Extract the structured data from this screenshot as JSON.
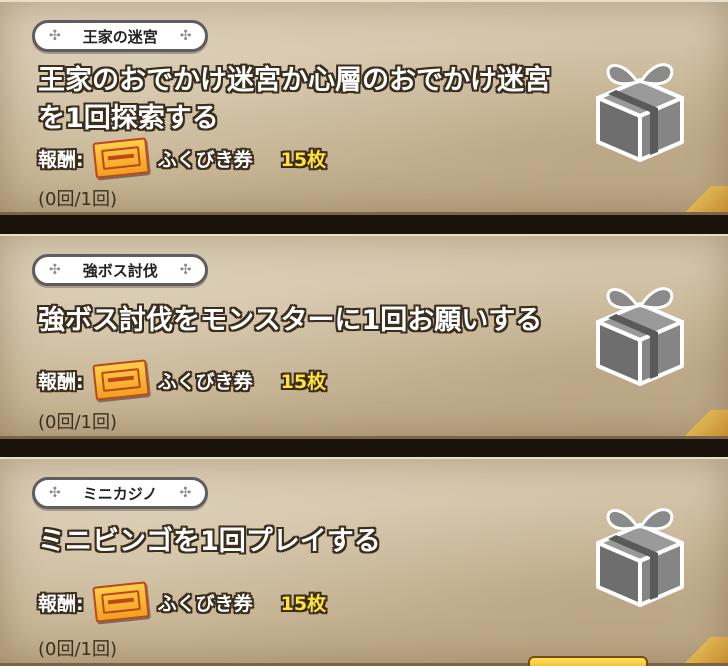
{
  "missions": [
    {
      "category": "王家の迷宮",
      "title_line1": "王家のおでかけ迷宮か心層のおでかけ迷宮",
      "title_line2": "を1回探索する",
      "reward_label": "報酬:",
      "reward_item": "ふくびき券",
      "reward_count": "15枚",
      "progress": "(0回/1回)",
      "reward_icon": "ticket-icon",
      "status_icon": "gift-box-icon"
    },
    {
      "category": "強ボス討伐",
      "title_line1": "強ボス討伐をモンスターに1回お願いする",
      "title_line2": "",
      "reward_label": "報酬:",
      "reward_item": "ふくびき券",
      "reward_count": "15枚",
      "progress": "(0回/1回)",
      "reward_icon": "ticket-icon",
      "status_icon": "gift-box-icon"
    },
    {
      "category": "ミニカジノ",
      "title_line1": "ミニビンゴを1回プレイする",
      "title_line2": "",
      "reward_label": "報酬:",
      "reward_item": "ふくびき券",
      "reward_count": "15枚",
      "progress": "(0回/1回)",
      "reward_icon": "ticket-icon",
      "status_icon": "gift-box-icon"
    }
  ],
  "colors": {
    "parchment": "#cdbc9c",
    "reward_count": "#ffe23a",
    "gift_gray": "#7a7a7a",
    "ticket": "#f0a020"
  }
}
